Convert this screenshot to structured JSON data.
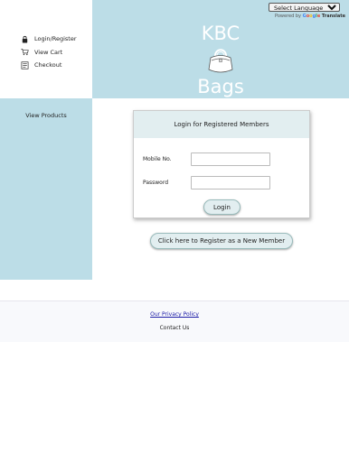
{
  "nav": {
    "items": [
      {
        "label": "Login/Register",
        "icon": "lock-icon"
      },
      {
        "label": "View Cart",
        "icon": "cart-icon"
      },
      {
        "label": "Checkout",
        "icon": "checklist-icon"
      }
    ]
  },
  "header": {
    "language_select": "Select Language",
    "powered_by": "Powered by",
    "google": "Google",
    "translate": "Translate",
    "brand_top": "KBC",
    "brand_bottom": "Bags",
    "bg_color": "#bcdde7"
  },
  "sidebar": {
    "view_products": "View Products"
  },
  "login": {
    "title": "Login for Registered Members",
    "mobile_label": "Mobile No.",
    "mobile_value": "",
    "password_label": "Password",
    "password_value": "",
    "button": "Login"
  },
  "register_button": "Click here to Register as a New Member",
  "footer": {
    "privacy": "Our Privacy Policy",
    "contact": "Contact Us"
  }
}
